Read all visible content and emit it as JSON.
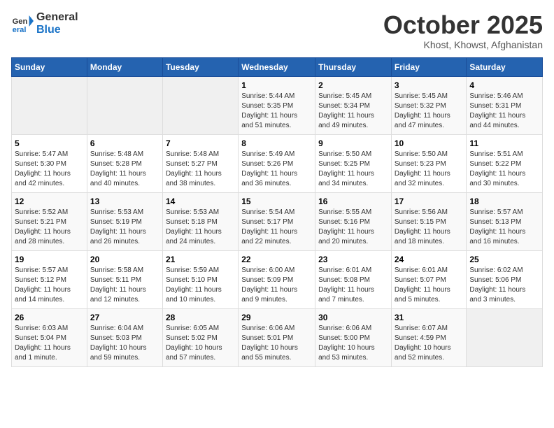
{
  "header": {
    "logo_line1": "General",
    "logo_line2": "Blue",
    "month": "October 2025",
    "location": "Khost, Khowst, Afghanistan"
  },
  "weekdays": [
    "Sunday",
    "Monday",
    "Tuesday",
    "Wednesday",
    "Thursday",
    "Friday",
    "Saturday"
  ],
  "weeks": [
    [
      {
        "day": "",
        "info": ""
      },
      {
        "day": "",
        "info": ""
      },
      {
        "day": "",
        "info": ""
      },
      {
        "day": "1",
        "info": "Sunrise: 5:44 AM\nSunset: 5:35 PM\nDaylight: 11 hours\nand 51 minutes."
      },
      {
        "day": "2",
        "info": "Sunrise: 5:45 AM\nSunset: 5:34 PM\nDaylight: 11 hours\nand 49 minutes."
      },
      {
        "day": "3",
        "info": "Sunrise: 5:45 AM\nSunset: 5:32 PM\nDaylight: 11 hours\nand 47 minutes."
      },
      {
        "day": "4",
        "info": "Sunrise: 5:46 AM\nSunset: 5:31 PM\nDaylight: 11 hours\nand 44 minutes."
      }
    ],
    [
      {
        "day": "5",
        "info": "Sunrise: 5:47 AM\nSunset: 5:30 PM\nDaylight: 11 hours\nand 42 minutes."
      },
      {
        "day": "6",
        "info": "Sunrise: 5:48 AM\nSunset: 5:28 PM\nDaylight: 11 hours\nand 40 minutes."
      },
      {
        "day": "7",
        "info": "Sunrise: 5:48 AM\nSunset: 5:27 PM\nDaylight: 11 hours\nand 38 minutes."
      },
      {
        "day": "8",
        "info": "Sunrise: 5:49 AM\nSunset: 5:26 PM\nDaylight: 11 hours\nand 36 minutes."
      },
      {
        "day": "9",
        "info": "Sunrise: 5:50 AM\nSunset: 5:25 PM\nDaylight: 11 hours\nand 34 minutes."
      },
      {
        "day": "10",
        "info": "Sunrise: 5:50 AM\nSunset: 5:23 PM\nDaylight: 11 hours\nand 32 minutes."
      },
      {
        "day": "11",
        "info": "Sunrise: 5:51 AM\nSunset: 5:22 PM\nDaylight: 11 hours\nand 30 minutes."
      }
    ],
    [
      {
        "day": "12",
        "info": "Sunrise: 5:52 AM\nSunset: 5:21 PM\nDaylight: 11 hours\nand 28 minutes."
      },
      {
        "day": "13",
        "info": "Sunrise: 5:53 AM\nSunset: 5:19 PM\nDaylight: 11 hours\nand 26 minutes."
      },
      {
        "day": "14",
        "info": "Sunrise: 5:53 AM\nSunset: 5:18 PM\nDaylight: 11 hours\nand 24 minutes."
      },
      {
        "day": "15",
        "info": "Sunrise: 5:54 AM\nSunset: 5:17 PM\nDaylight: 11 hours\nand 22 minutes."
      },
      {
        "day": "16",
        "info": "Sunrise: 5:55 AM\nSunset: 5:16 PM\nDaylight: 11 hours\nand 20 minutes."
      },
      {
        "day": "17",
        "info": "Sunrise: 5:56 AM\nSunset: 5:15 PM\nDaylight: 11 hours\nand 18 minutes."
      },
      {
        "day": "18",
        "info": "Sunrise: 5:57 AM\nSunset: 5:13 PM\nDaylight: 11 hours\nand 16 minutes."
      }
    ],
    [
      {
        "day": "19",
        "info": "Sunrise: 5:57 AM\nSunset: 5:12 PM\nDaylight: 11 hours\nand 14 minutes."
      },
      {
        "day": "20",
        "info": "Sunrise: 5:58 AM\nSunset: 5:11 PM\nDaylight: 11 hours\nand 12 minutes."
      },
      {
        "day": "21",
        "info": "Sunrise: 5:59 AM\nSunset: 5:10 PM\nDaylight: 11 hours\nand 10 minutes."
      },
      {
        "day": "22",
        "info": "Sunrise: 6:00 AM\nSunset: 5:09 PM\nDaylight: 11 hours\nand 9 minutes."
      },
      {
        "day": "23",
        "info": "Sunrise: 6:01 AM\nSunset: 5:08 PM\nDaylight: 11 hours\nand 7 minutes."
      },
      {
        "day": "24",
        "info": "Sunrise: 6:01 AM\nSunset: 5:07 PM\nDaylight: 11 hours\nand 5 minutes."
      },
      {
        "day": "25",
        "info": "Sunrise: 6:02 AM\nSunset: 5:06 PM\nDaylight: 11 hours\nand 3 minutes."
      }
    ],
    [
      {
        "day": "26",
        "info": "Sunrise: 6:03 AM\nSunset: 5:04 PM\nDaylight: 11 hours\nand 1 minute."
      },
      {
        "day": "27",
        "info": "Sunrise: 6:04 AM\nSunset: 5:03 PM\nDaylight: 10 hours\nand 59 minutes."
      },
      {
        "day": "28",
        "info": "Sunrise: 6:05 AM\nSunset: 5:02 PM\nDaylight: 10 hours\nand 57 minutes."
      },
      {
        "day": "29",
        "info": "Sunrise: 6:06 AM\nSunset: 5:01 PM\nDaylight: 10 hours\nand 55 minutes."
      },
      {
        "day": "30",
        "info": "Sunrise: 6:06 AM\nSunset: 5:00 PM\nDaylight: 10 hours\nand 53 minutes."
      },
      {
        "day": "31",
        "info": "Sunrise: 6:07 AM\nSunset: 4:59 PM\nDaylight: 10 hours\nand 52 minutes."
      },
      {
        "day": "",
        "info": ""
      }
    ]
  ]
}
